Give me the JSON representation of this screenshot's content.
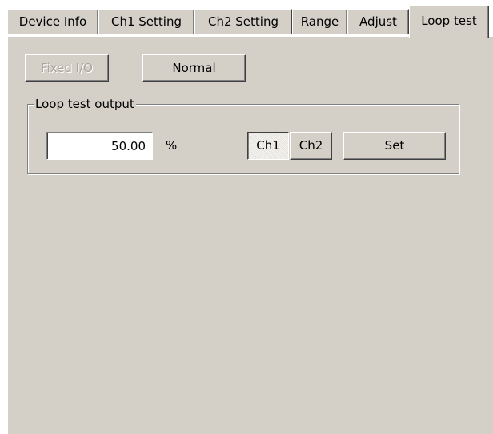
{
  "tabs": [
    {
      "label": "Device Info",
      "active": false
    },
    {
      "label": "Ch1 Setting",
      "active": false
    },
    {
      "label": "Ch2 Setting",
      "active": false
    },
    {
      "label": "Range",
      "active": false
    },
    {
      "label": "Adjust",
      "active": false
    },
    {
      "label": "Loop test",
      "active": true
    }
  ],
  "mode_buttons": {
    "fixed_io": {
      "label": "Fixed I/O",
      "enabled": false
    },
    "normal": {
      "label": "Normal",
      "enabled": true
    }
  },
  "loop_test": {
    "group_label": "Loop test output",
    "output_value": "50.00",
    "unit": "%",
    "channels": [
      {
        "label": "Ch1",
        "selected": true
      },
      {
        "label": "Ch2",
        "selected": false
      }
    ],
    "set_label": "Set"
  },
  "colors": {
    "face": "#d4d0c8",
    "highlight": "#ffffff",
    "shadow": "#808080",
    "dark_shadow": "#404040",
    "disabled_text": "#a8a49c"
  }
}
